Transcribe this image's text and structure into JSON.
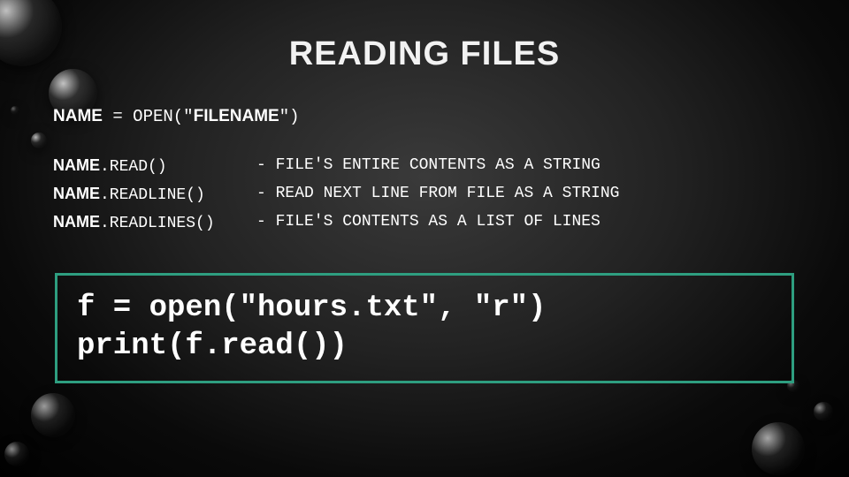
{
  "title": "READING FILES",
  "syntax": {
    "name_bold": "NAME",
    "equals": " = ",
    "open_call_prefix": "OPEN(\"",
    "filename_bold": "FILENAME",
    "open_call_suffix": "\")"
  },
  "methods": [
    {
      "name_bold": "NAME",
      "call": ".READ()",
      "desc": "- FILE'S ENTIRE CONTENTS AS A STRING"
    },
    {
      "name_bold": "NAME",
      "call": ".READLINE()",
      "desc": "- READ NEXT LINE FROM FILE AS A STRING"
    },
    {
      "name_bold": "NAME",
      "call": ".READLINES()",
      "desc": "- FILE'S CONTENTS AS A LIST OF LINES"
    }
  ],
  "codebox": {
    "line1": "f = open(\"hours.txt\", \"r\")",
    "line2": "print(f.read())"
  }
}
